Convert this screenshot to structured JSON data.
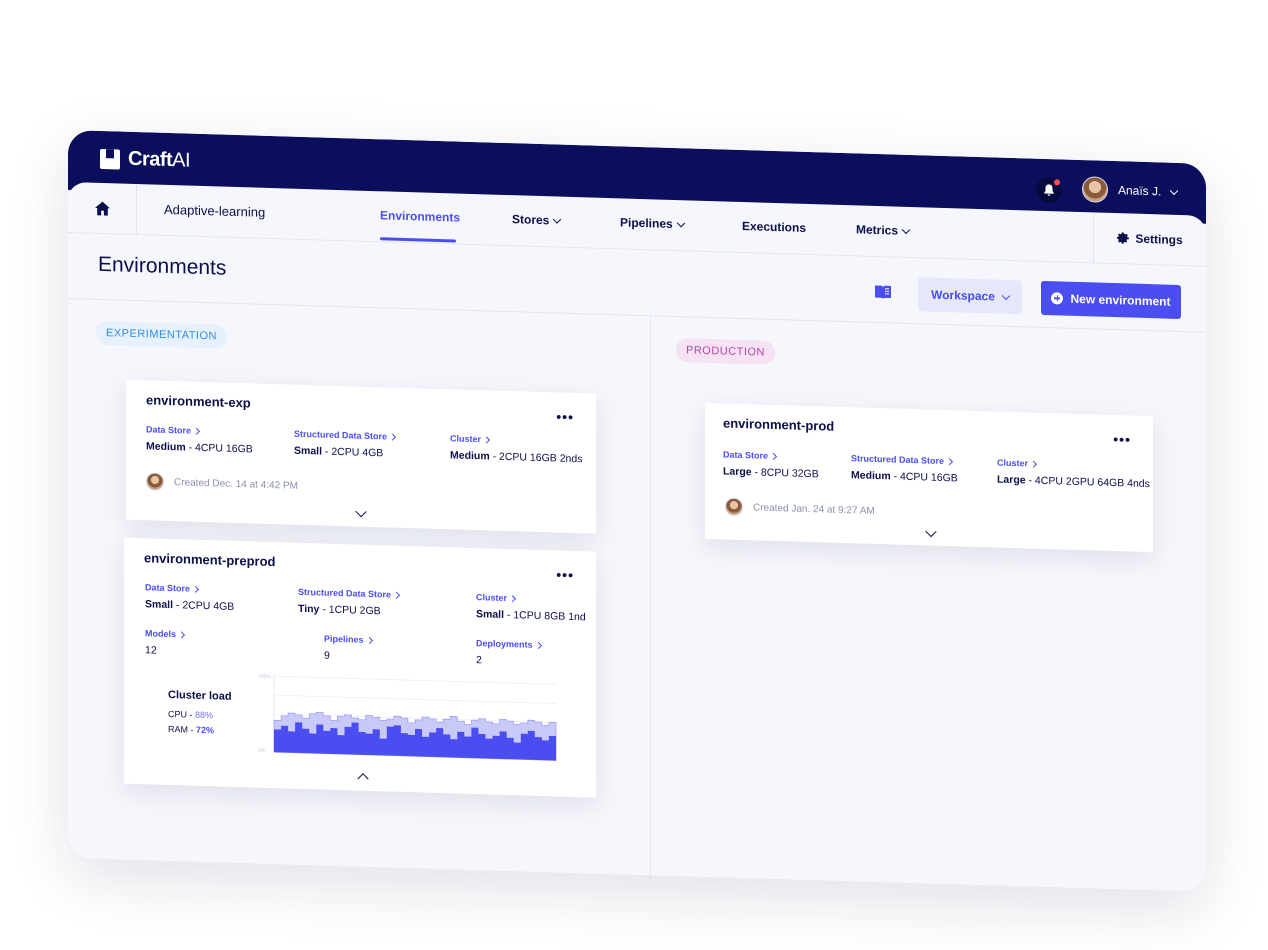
{
  "app": {
    "logo_text": "Craft",
    "logo_suffix": "AI"
  },
  "user": {
    "name": "Anaïs J."
  },
  "nav": {
    "project": "Adaptive-learning",
    "items": [
      {
        "label": "Environments",
        "active": true
      },
      {
        "label": "Stores",
        "dropdown": true
      },
      {
        "label": "Pipelines",
        "dropdown": true
      },
      {
        "label": "Executions"
      },
      {
        "label": "Metrics",
        "dropdown": true
      }
    ],
    "settings": "Settings"
  },
  "page": {
    "title": "Environments",
    "workspace_label": "Workspace",
    "new_button": "New environment"
  },
  "columns": {
    "experimentation": "EXPERIMENTATION",
    "production": "PRODUCTION"
  },
  "cards": {
    "exp": {
      "name": "environment-exp",
      "data_store": {
        "label": "Data Store",
        "size": "Medium",
        "spec": " - 4CPU 16GB"
      },
      "structured": {
        "label": "Structured Data Store",
        "size": "Small",
        "spec": " - 2CPU 4GB"
      },
      "cluster": {
        "label": "Cluster",
        "size": "Medium",
        "spec": " - 2CPU 16GB 2nds"
      },
      "created": "Created Dec. 14 at 4:42 PM"
    },
    "preprod": {
      "name": "environment-preprod",
      "data_store": {
        "label": "Data Store",
        "size": "Small",
        "spec": " - 2CPU 4GB"
      },
      "structured": {
        "label": "Structured Data Store",
        "size": "Tiny",
        "spec": " - 1CPU 2GB"
      },
      "cluster": {
        "label": "Cluster",
        "size": "Small",
        "spec": " - 1CPU 8GB 1nd"
      },
      "models": {
        "label": "Models",
        "value": "12"
      },
      "pipelines": {
        "label": "Pipelines",
        "value": "9"
      },
      "deployments": {
        "label": "Deployments",
        "value": "2"
      },
      "cluster_load": {
        "title": "Cluster load",
        "cpu_label": "CPU - ",
        "cpu_value": "88%",
        "ram_label": "RAM - ",
        "ram_value": "72%"
      }
    },
    "prod": {
      "name": "environment-prod",
      "data_store": {
        "label": "Data Store",
        "size": "Large",
        "spec": " - 8CPU 32GB"
      },
      "structured": {
        "label": "Structured Data Store",
        "size": "Medium",
        "spec": " - 4CPU 16GB"
      },
      "cluster": {
        "label": "Cluster",
        "size": "Large",
        "spec": " - 4CPU 2GPU 64GB 4nds"
      },
      "created": "Created Jan. 24 at 9:27 AM"
    }
  },
  "chart_data": {
    "type": "area",
    "title": "Cluster load",
    "y_tick_labels": [
      "100%",
      "0%"
    ],
    "ylim": [
      0,
      100
    ],
    "series": [
      {
        "name": "CPU",
        "values": [
          30,
          35,
          28,
          40,
          32,
          26,
          38,
          30,
          34,
          25,
          36,
          42,
          30,
          28,
          34,
          22,
          38,
          40,
          30,
          28,
          36,
          26,
          32,
          38,
          30,
          24,
          34,
          28,
          40,
          32,
          26,
          30,
          36,
          28,
          22,
          34,
          38,
          30,
          26,
          32
        ],
        "color": "#4a4df0"
      },
      {
        "name": "RAM",
        "values": [
          42,
          48,
          52,
          50,
          46,
          52,
          54,
          50,
          44,
          50,
          52,
          48,
          46,
          52,
          50,
          46,
          48,
          52,
          50,
          44,
          48,
          52,
          50,
          46,
          50,
          54,
          48,
          44,
          50,
          52,
          48,
          46,
          52,
          50,
          46,
          48,
          52,
          50,
          46,
          50
        ],
        "color": "#c9c9f7"
      }
    ],
    "grid": true
  }
}
